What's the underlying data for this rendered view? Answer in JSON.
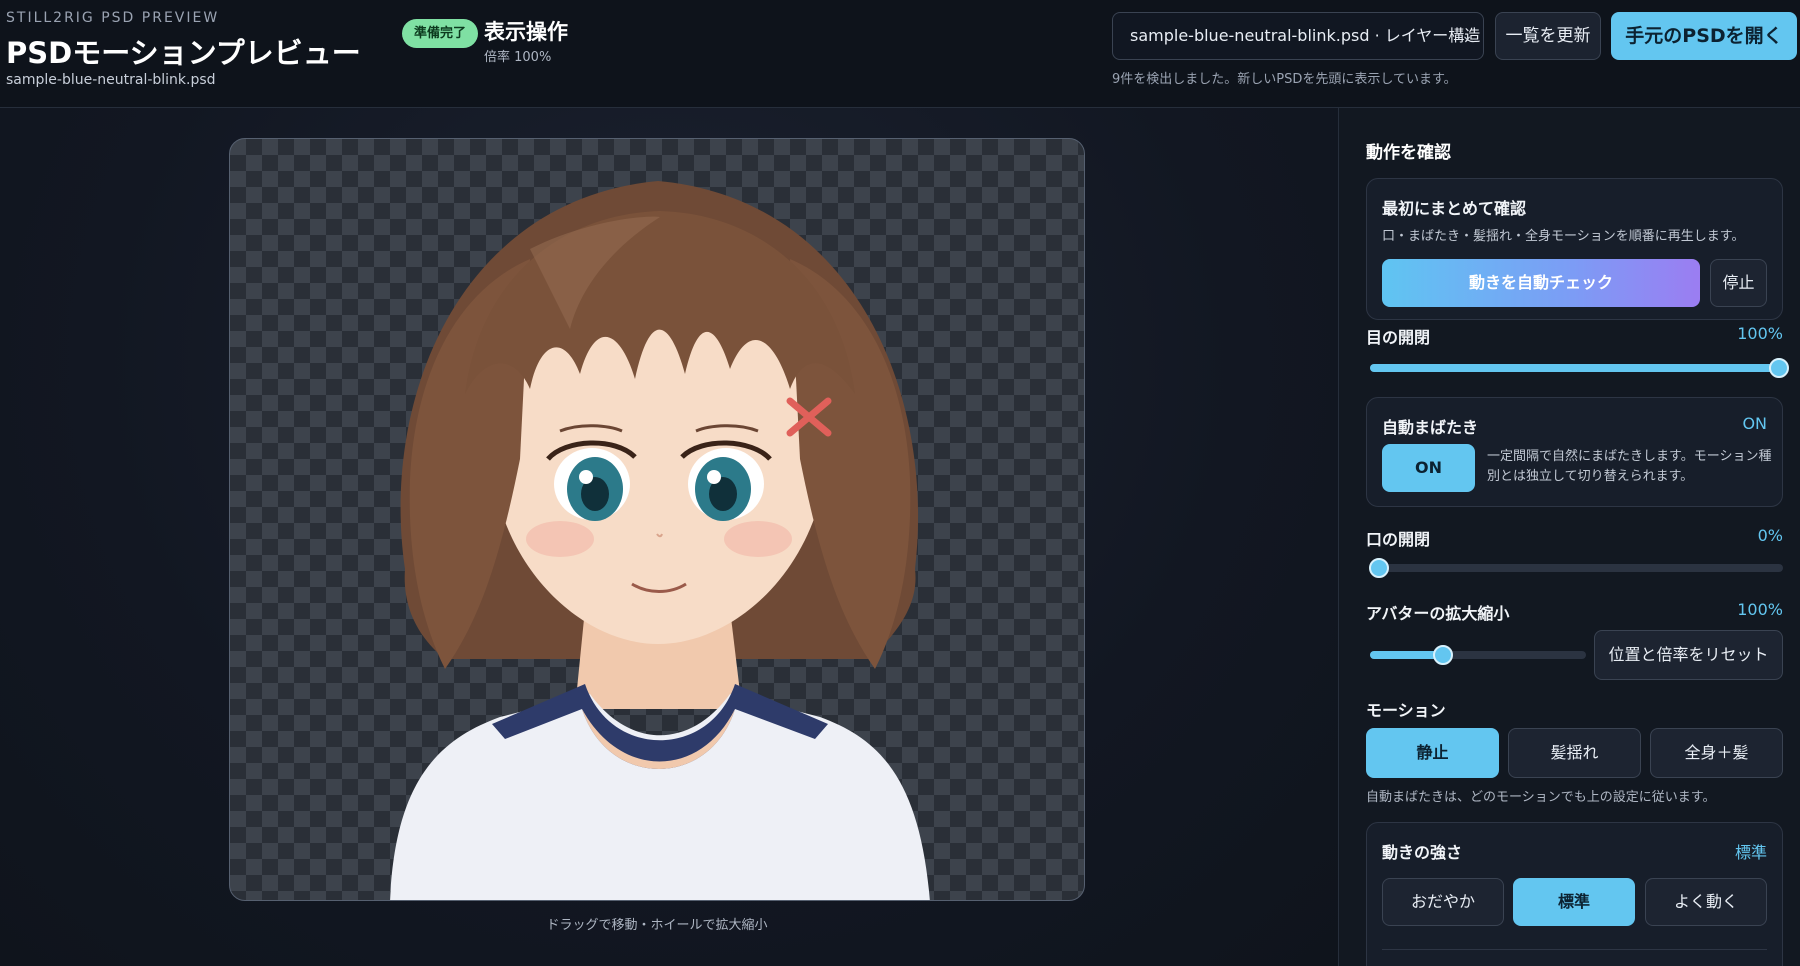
{
  "header": {
    "eyebrow": "STILL2RIG PSD PREVIEW",
    "title": "PSDモーションプレビュー",
    "file_name": "sample-blue-neutral-blink.psd",
    "status_badge": "準備完了",
    "view_title": "表示操作",
    "zoom_text": "倍率 100%",
    "psd_select_value": "sample-blue-neutral-blink.psd · レイヤー構造",
    "refresh_label": "一覧を更新",
    "open_label": "手元のPSDを開く",
    "detect_note": "9件を検出しました。新しいPSDを先頭に表示しています。"
  },
  "stage": {
    "hint": "ドラッグで移動・ホイールで拡大縮小"
  },
  "panel": {
    "title": "動作を確認",
    "auto_check": {
      "heading": "最初にまとめて確認",
      "desc": "口・まばたき・髪揺れ・全身モーションを順番に再生します。",
      "run_label": "動きを自動チェック",
      "stop_label": "停止"
    },
    "eye": {
      "label": "目の開閉",
      "value_text": "100%",
      "value": 1.0
    },
    "blink": {
      "heading": "自動まばたき",
      "state_text": "ON",
      "toggle_label": "ON",
      "desc": "一定間隔で自然にまばたきします。モーション種別とは独立して切り替えられます。"
    },
    "mouth": {
      "label": "口の開閉",
      "value_text": "0%",
      "value": 0.0
    },
    "scale": {
      "label": "アバターの拡大縮小",
      "value_text": "100%",
      "value": 0.34,
      "reset_label": "位置と倍率をリセット"
    },
    "motion": {
      "label": "モーション",
      "options": [
        "静止",
        "髪揺れ",
        "全身＋髪"
      ],
      "selected": "静止",
      "note": "自動まばたきは、どのモーションでも上の設定に従います。"
    },
    "strength": {
      "heading": "動きの強さ",
      "value_text": "標準",
      "options": [
        "おだやか",
        "標準",
        "よく動く"
      ],
      "selected": "標準"
    }
  },
  "colors": {
    "accent": "#63c6f0",
    "badge_green": "#7fe0a3",
    "bg": "#0f141d"
  }
}
